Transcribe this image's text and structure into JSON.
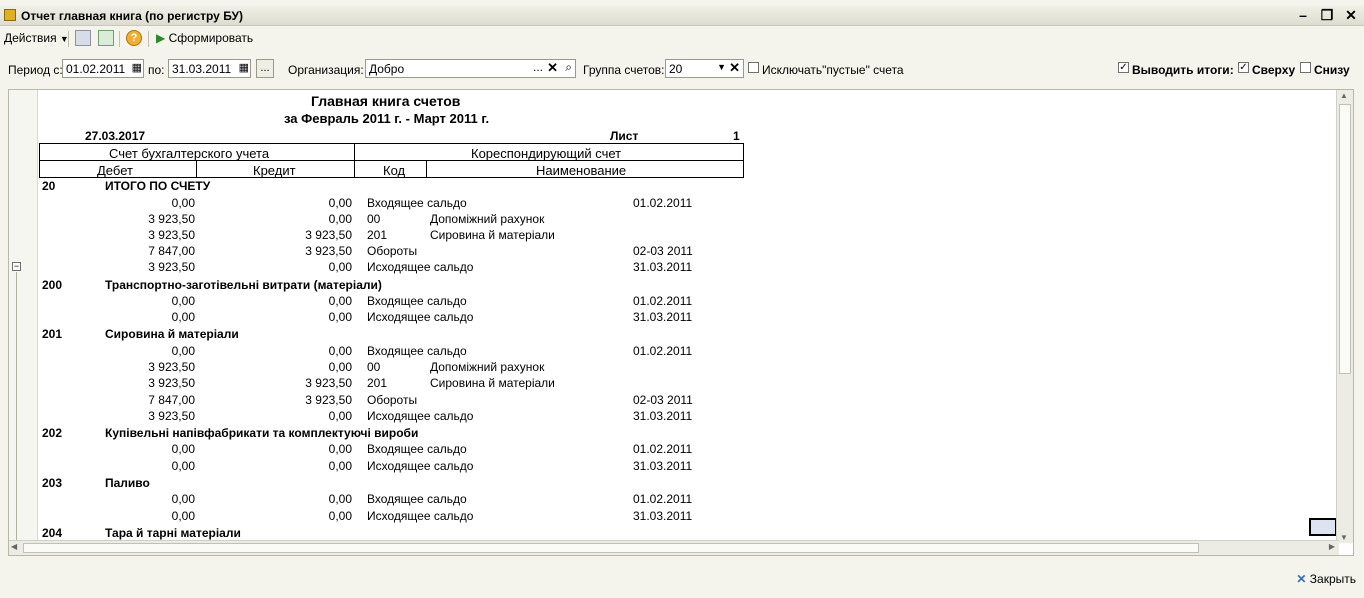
{
  "window": {
    "title": "Отчет главная книга (по регистру БУ)"
  },
  "toolbar": {
    "actions_label": "Действия",
    "generate_label": "Сформировать"
  },
  "params": {
    "period_from_label": "Период с:",
    "period_from": "01.02.2011",
    "period_to_label": "по:",
    "period_to": "31.03.2011",
    "ellipsis": "...",
    "org_label": "Организация:",
    "org_value": "Добро",
    "group_label": "Группа счетов:",
    "group_value": "20",
    "exclude_empty_label": "Исключать\"пустые\" счета",
    "show_totals_label": "Выводить итоги:",
    "top_label": "Сверху",
    "bottom_label": "Снизу",
    "exclude_empty_checked": false,
    "show_totals_checked": true,
    "top_checked": true,
    "bottom_checked": false
  },
  "report": {
    "title": "Главная книга счетов",
    "subtitle": "за Февраль 2011 г. - Март 2011 г.",
    "date": "27.03.2017",
    "sheet_label": "Лист",
    "sheet_no": "1",
    "header": {
      "account": "Счет бухгалтерского учета",
      "corr": "Кореспондирующий счет",
      "debit": "Дебет",
      "credit": "Кредит",
      "code": "Код",
      "name": "Наименование"
    },
    "rows": [
      {
        "type": "group",
        "code": "20",
        "name": "ИТОГО ПО СЧЕТУ"
      },
      {
        "type": "line",
        "debit": "0,00",
        "credit": "0,00",
        "code": "Входящее сальдо",
        "name": "",
        "date": "01.02.2011"
      },
      {
        "type": "line",
        "debit": "3 923,50",
        "credit": "0,00",
        "code": "00",
        "name": "Допоміжний рахунок",
        "date": ""
      },
      {
        "type": "line",
        "debit": "3 923,50",
        "credit": "3 923,50",
        "code": "201",
        "name": "Сировина й матеріали",
        "date": ""
      },
      {
        "type": "line",
        "debit": "7 847,00",
        "credit": "3 923,50",
        "code": "Обороты",
        "name": "",
        "date": "02-03 2011"
      },
      {
        "type": "line",
        "debit": "3 923,50",
        "credit": "0,00",
        "code": "Исходящее сальдо",
        "name": "",
        "date": "31.03.2011"
      },
      {
        "type": "group",
        "code": "200",
        "name": "Транспортно-заготівельні витрати (матеріали)"
      },
      {
        "type": "line",
        "debit": "0,00",
        "credit": "0,00",
        "code": "Входящее сальдо",
        "name": "",
        "date": "01.02.2011"
      },
      {
        "type": "line",
        "debit": "0,00",
        "credit": "0,00",
        "code": "Исходящее сальдо",
        "name": "",
        "date": "31.03.2011"
      },
      {
        "type": "group",
        "code": "201",
        "name": "Сировина й матеріали"
      },
      {
        "type": "line",
        "debit": "0,00",
        "credit": "0,00",
        "code": "Входящее сальдо",
        "name": "",
        "date": "01.02.2011"
      },
      {
        "type": "line",
        "debit": "3 923,50",
        "credit": "0,00",
        "code": "00",
        "name": "Допоміжний рахунок",
        "date": ""
      },
      {
        "type": "line",
        "debit": "3 923,50",
        "credit": "3 923,50",
        "code": "201",
        "name": "Сировина й матеріали",
        "date": ""
      },
      {
        "type": "line",
        "debit": "7 847,00",
        "credit": "3 923,50",
        "code": "Обороты",
        "name": "",
        "date": "02-03 2011"
      },
      {
        "type": "line",
        "debit": "3 923,50",
        "credit": "0,00",
        "code": "Исходящее сальдо",
        "name": "",
        "date": "31.03.2011"
      },
      {
        "type": "group",
        "code": "202",
        "name": "Купівельні напівфабрикати та комплектуючі вироби"
      },
      {
        "type": "line",
        "debit": "0,00",
        "credit": "0,00",
        "code": "Входящее сальдо",
        "name": "",
        "date": "01.02.2011"
      },
      {
        "type": "line",
        "debit": "0,00",
        "credit": "0,00",
        "code": "Исходящее сальдо",
        "name": "",
        "date": "31.03.2011"
      },
      {
        "type": "group",
        "code": "203",
        "name": "Паливо"
      },
      {
        "type": "line",
        "debit": "0,00",
        "credit": "0,00",
        "code": "Входящее сальдо",
        "name": "",
        "date": "01.02.2011"
      },
      {
        "type": "line",
        "debit": "0,00",
        "credit": "0,00",
        "code": "Исходящее сальдо",
        "name": "",
        "date": "31.03.2011"
      },
      {
        "type": "group",
        "code": "204",
        "name": "Тара й тарні матеріали"
      }
    ]
  },
  "footer": {
    "close_label": "Закрыть"
  }
}
